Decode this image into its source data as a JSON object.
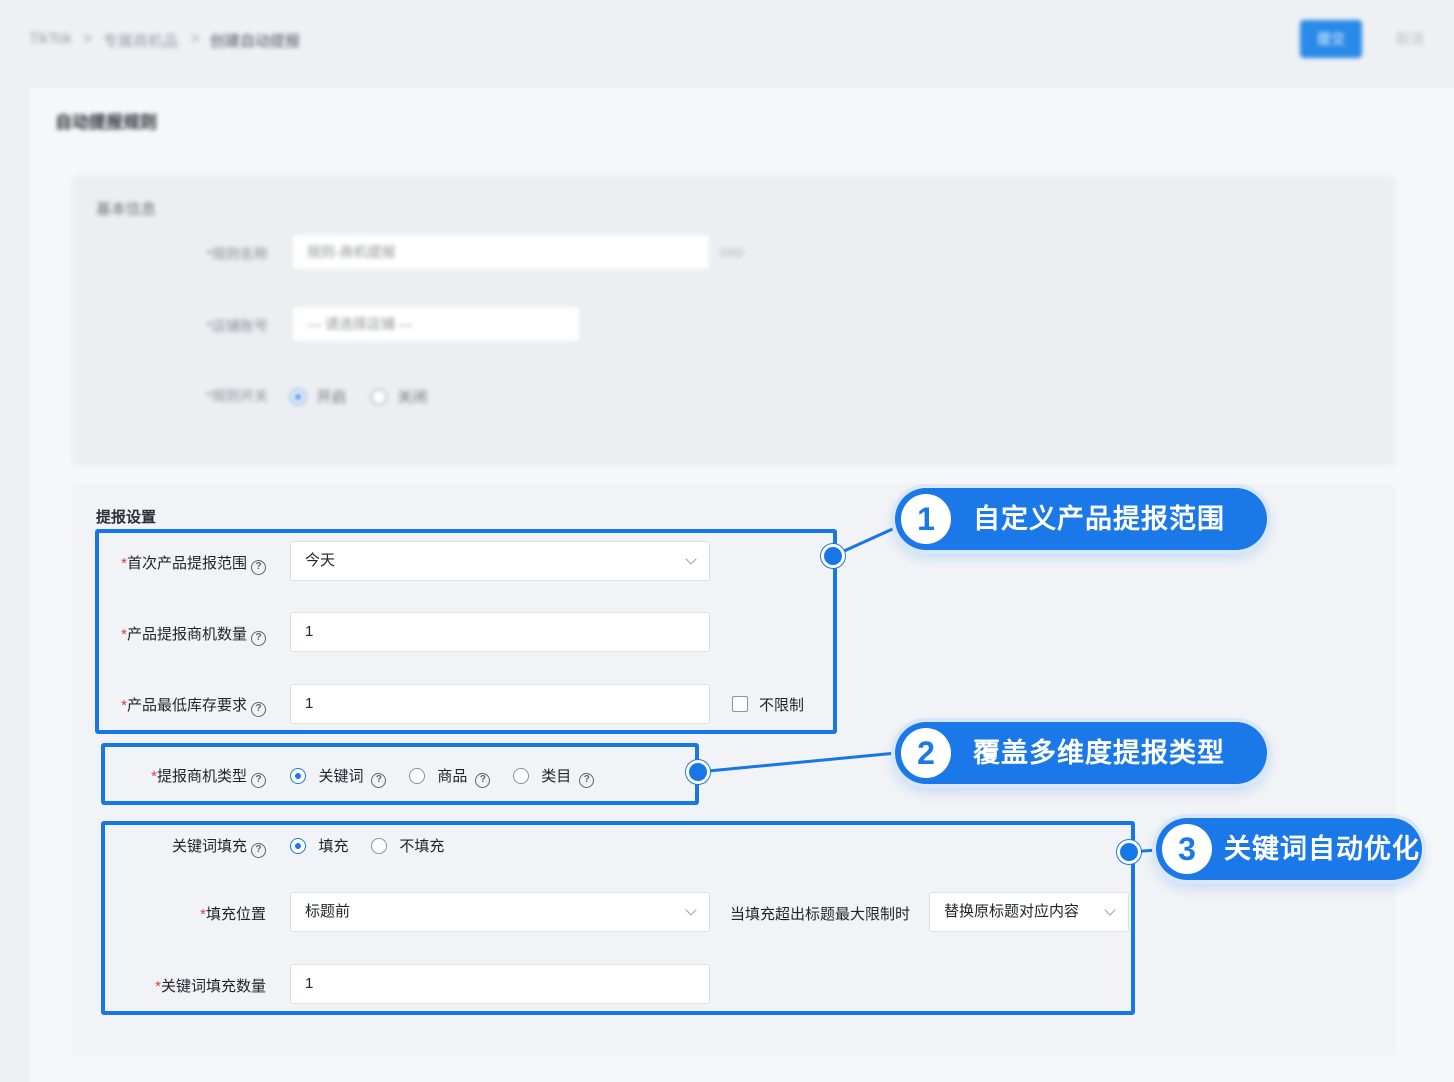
{
  "breadcrumb": {
    "items": [
      "TikTok",
      "专属商机品",
      "创建自动提报"
    ],
    "separator": ">"
  },
  "header": {
    "primary_button": "提交",
    "secondary_button": "取消"
  },
  "page": {
    "card_title": "自动提报规则"
  },
  "basic_section": {
    "title": "基本信息",
    "fields": [
      {
        "label": "*规则名称",
        "value": "规则-商机提报",
        "suffix": "0/50"
      },
      {
        "label": "*店铺账号",
        "value": "— 请选择店铺 —"
      },
      {
        "label": "*规则开关",
        "option_on": "开启",
        "option_off": "关闭"
      }
    ]
  },
  "report_section": {
    "title": "提报设置",
    "first_range": {
      "label": "首次产品提报范围",
      "value": "今天"
    },
    "count": {
      "label": "产品提报商机数量",
      "value": "1"
    },
    "stock": {
      "label": "产品最低库存要求",
      "value": "1",
      "unlimited_label": "不限制"
    },
    "type": {
      "label": "提报商机类型",
      "options": [
        "关键词",
        "商品",
        "类目"
      ],
      "selected": "关键词"
    },
    "kw_fill": {
      "label": "关键词填充",
      "options": [
        "填充",
        "不填充"
      ],
      "selected": "填充"
    },
    "fill_position": {
      "label": "填充位置",
      "value": "标题前",
      "overflow_label": "当填充超出标题最大限制时",
      "overflow_value": "替换原标题对应内容"
    },
    "kw_count": {
      "label": "关键词填充数量",
      "value": "1"
    }
  },
  "annotations": [
    {
      "num": "1",
      "text": "自定义产品提报范围"
    },
    {
      "num": "2",
      "text": "覆盖多维度提报类型"
    },
    {
      "num": "3",
      "text": "关键词自动优化"
    }
  ],
  "colors": {
    "accent": "#1877e6",
    "required": "#e23d3d"
  }
}
